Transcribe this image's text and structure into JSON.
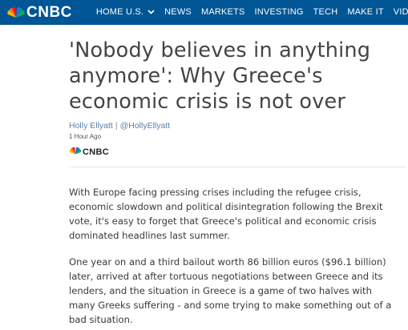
{
  "nav": {
    "brand": "CNBC",
    "items": [
      {
        "label": "HOME U.S.",
        "has_dropdown": true
      },
      {
        "label": "NEWS"
      },
      {
        "label": "MARKETS"
      },
      {
        "label": "INVESTING"
      },
      {
        "label": "TECH"
      },
      {
        "label": "MAKE IT"
      },
      {
        "label": "VIDEO"
      }
    ],
    "background": "#005594"
  },
  "article": {
    "title": "'Nobody believes in anything anymore': Why Greece's economic crisis is not over",
    "author": "Holly Ellyatt",
    "author_handle": "@HollyEllyatt",
    "byline_separator": "|",
    "published": "1 Hour Ago",
    "source": "CNBC",
    "paragraphs": [
      "With Europe facing pressing crises including the refugee crisis, economic slowdown and political disintegration following the Brexit vote, it's easy to forget that Greece's political and economic crisis dominated headlines last summer.",
      "One year on and a third bailout worth 86 billion euros ($96.1 billion) later, arrived at after tortuous negotiations between Greece and its lenders, and the situation in Greece is a game of two halves with many Greeks suffering - and some trying to make something out of a bad situation."
    ]
  },
  "icons": {
    "brand_logo": "peacock-icon",
    "dropdown": "chevron-down-icon"
  }
}
